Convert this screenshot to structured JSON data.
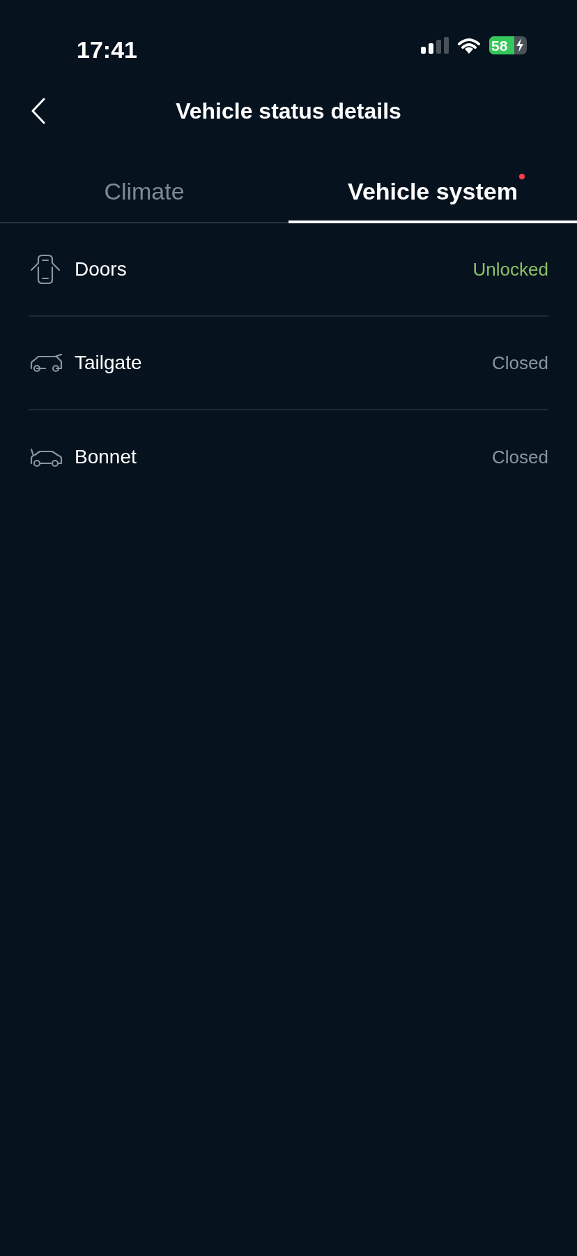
{
  "status_bar": {
    "time": "17:41",
    "battery": "58",
    "charging": true
  },
  "header": {
    "title": "Vehicle status details"
  },
  "tabs": [
    {
      "label": "Climate",
      "selected": false,
      "badge": false
    },
    {
      "label": "Vehicle system",
      "selected": true,
      "badge": true
    }
  ],
  "items": [
    {
      "kind": "doors",
      "label": "Doors",
      "status": "Unlocked",
      "alert": true
    },
    {
      "kind": "tailgate",
      "label": "Tailgate",
      "status": "Closed",
      "alert": false
    },
    {
      "kind": "bonnet",
      "label": "Bonnet",
      "status": "Closed",
      "alert": false
    }
  ]
}
